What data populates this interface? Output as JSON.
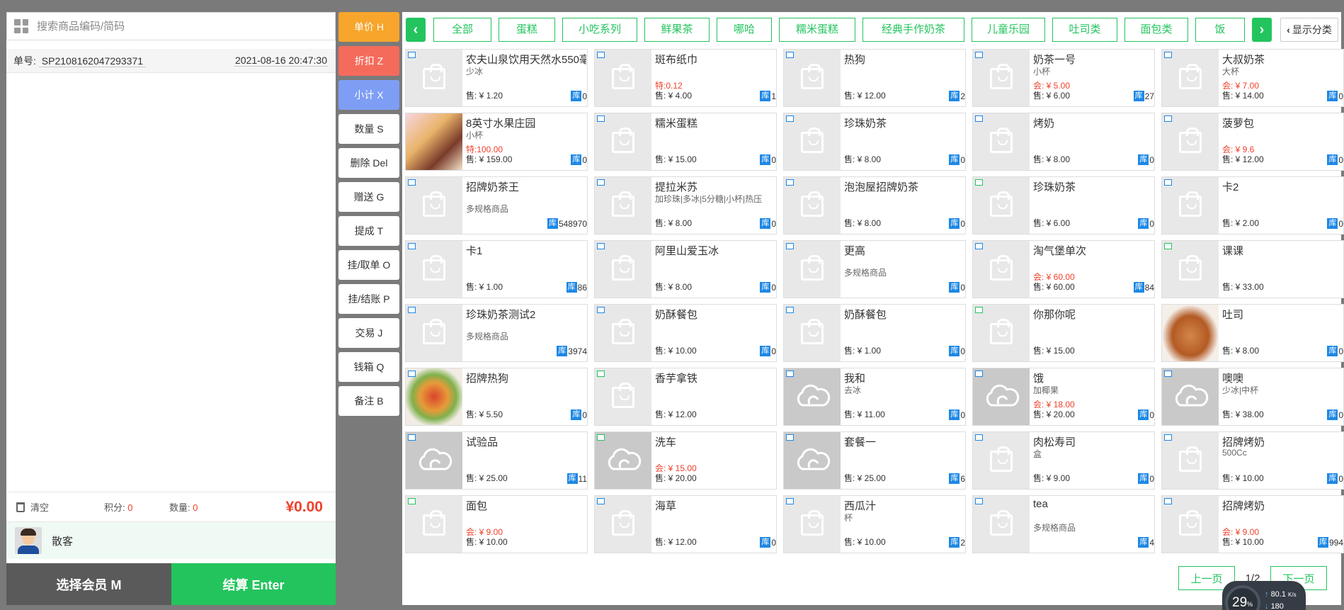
{
  "search": {
    "placeholder": "搜索商品编码/简码"
  },
  "order": {
    "no_label": "单号:",
    "no": "SP2108162047293371",
    "datetime": "2021-08-16 20:47:30"
  },
  "summary": {
    "clear": "清空",
    "points_label": "积分:",
    "points": "0",
    "qty_label": "数量:",
    "qty": "0",
    "total": "¥0.00"
  },
  "member": {
    "name": "散客"
  },
  "bottom": {
    "select_member": "选择会员 M",
    "settle": "结算 Enter"
  },
  "functions": [
    {
      "label": "单价 H",
      "style": "orange"
    },
    {
      "label": "折扣 Z",
      "style": "red"
    },
    {
      "label": "小计 X",
      "style": "blue"
    },
    {
      "label": "数量 S",
      "style": ""
    },
    {
      "label": "删除 Del",
      "style": ""
    },
    {
      "label": "赠送 G",
      "style": ""
    },
    {
      "label": "提成 T",
      "style": ""
    },
    {
      "label": "挂/取单 O",
      "style": ""
    },
    {
      "label": "挂/结账 P",
      "style": ""
    },
    {
      "label": "交易 J",
      "style": ""
    },
    {
      "label": "钱箱 Q",
      "style": ""
    },
    {
      "label": "备注 B",
      "style": ""
    }
  ],
  "categories": [
    "全部",
    "蛋糕",
    "小吃系列",
    "鲜果茶",
    "哪哈",
    "糯米蛋糕",
    "经典手作奶茶",
    "儿童乐园",
    "吐司类",
    "面包类",
    "饭"
  ],
  "show_categories": "显示分类",
  "stock_label": "库",
  "products": [
    {
      "name": "农夫山泉饮用天然水550毫",
      "sub": "少冰",
      "price": "售: ¥ 1.20",
      "stock": "0",
      "thumb": "bag",
      "tag": "b"
    },
    {
      "name": "斑布纸巾",
      "promo": "特:0.12",
      "price": "售: ¥ 4.00",
      "stock": "1",
      "thumb": "bag",
      "tag": "b"
    },
    {
      "name": "热狗",
      "price": "售: ¥ 12.00",
      "stock": "2",
      "thumb": "bag",
      "tag": "b"
    },
    {
      "name": "奶茶一号",
      "sub": "小杯",
      "promo": "会: ¥ 5.00",
      "price": "售: ¥ 6.00",
      "stock": "27",
      "thumb": "bag",
      "tag": "b"
    },
    {
      "name": "大叔奶茶",
      "sub": "大杯",
      "promo": "会: ¥ 7.00",
      "price": "售: ¥ 14.00",
      "stock": "0",
      "thumb": "bag",
      "tag": "b"
    },
    {
      "name": "8英寸水果庄园",
      "sub": "小杯",
      "promo": "特:100.00",
      "price": "售: ¥ 159.00",
      "stock": "0",
      "thumb": "cake",
      "tag": ""
    },
    {
      "name": "糯米蛋糕",
      "price": "售: ¥ 15.00",
      "stock": "0",
      "thumb": "bag",
      "tag": "b"
    },
    {
      "name": "珍珠奶茶",
      "price": "售: ¥ 8.00",
      "stock": "0",
      "thumb": "bag",
      "tag": "b"
    },
    {
      "name": "烤奶",
      "price": "售: ¥ 8.00",
      "stock": "0",
      "thumb": "bag",
      "tag": "b"
    },
    {
      "name": "菠萝包",
      "promo": "会: ¥ 9.6",
      "price": "售: ¥ 12.00",
      "stock": "0",
      "thumb": "bag",
      "tag": "b"
    },
    {
      "name": "招牌奶茶王",
      "spec": "多规格商品",
      "stock": "548970",
      "thumb": "bag",
      "tag": "b"
    },
    {
      "name": "提拉米苏",
      "sub": "加珍珠|多冰|5分糖|小杯|热压",
      "price": "售: ¥ 8.00",
      "stock": "0",
      "thumb": "bag",
      "tag": "b"
    },
    {
      "name": "泡泡屋招牌奶茶",
      "price": "售: ¥ 8.00",
      "stock": "0",
      "thumb": "bag",
      "tag": "b"
    },
    {
      "name": "珍珠奶茶",
      "price": "售: ¥ 6.00",
      "stock": "0",
      "thumb": "bag",
      "tag": "g"
    },
    {
      "name": "卡2",
      "price": "售: ¥ 2.00",
      "stock": "0",
      "thumb": "bag",
      "tag": "b"
    },
    {
      "name": "卡1",
      "price": "售: ¥ 1.00",
      "stock": "86",
      "thumb": "bag",
      "tag": "b"
    },
    {
      "name": "阿里山爱玉冰",
      "price": "售: ¥ 8.00",
      "stock": "0",
      "thumb": "bag",
      "tag": "b"
    },
    {
      "name": "更高",
      "spec": "多规格商品",
      "stock": "0",
      "thumb": "bag",
      "tag": "b"
    },
    {
      "name": "淘气堡单次",
      "promo": "会: ¥ 60.00",
      "price": "售: ¥ 60.00",
      "stock": "84",
      "thumb": "bag",
      "tag": "b"
    },
    {
      "name": "课课",
      "price": "售: ¥ 33.00",
      "thumb": "bag",
      "tag": "g"
    },
    {
      "name": "珍珠奶茶测试2",
      "spec": "多规格商品",
      "stock": "3974",
      "thumb": "bag",
      "tag": "b"
    },
    {
      "name": "奶酥餐包",
      "price": "售: ¥ 10.00",
      "stock": "0",
      "thumb": "bag",
      "tag": "b"
    },
    {
      "name": "奶酥餐包",
      "price": "售: ¥ 1.00",
      "stock": "0",
      "thumb": "bag",
      "tag": "b"
    },
    {
      "name": "你那你呢",
      "price": "售: ¥ 15.00",
      "thumb": "bag",
      "tag": "g"
    },
    {
      "name": "吐司",
      "price": "售: ¥ 8.00",
      "stock": "0",
      "thumb": "bread",
      "tag": ""
    },
    {
      "name": "招牌热狗",
      "price": "售: ¥ 5.50",
      "stock": "0",
      "thumb": "hotdog",
      "tag": "b"
    },
    {
      "name": "香芋拿铁",
      "price": "售: ¥ 12.00",
      "thumb": "bag",
      "tag": "g"
    },
    {
      "name": "我和",
      "sub": "去冰",
      "price": "售: ¥ 11.00",
      "stock": "0",
      "thumb": "cloud",
      "tag": "b"
    },
    {
      "name": "饿",
      "sub": "加椰果",
      "promo": "会: ¥ 18.00",
      "price": "售: ¥ 20.00",
      "stock": "0",
      "thumb": "cloud",
      "tag": "b"
    },
    {
      "name": "噢噢",
      "sub": "少冰|中杯",
      "price": "售: ¥ 38.00",
      "stock": "0",
      "thumb": "cloud",
      "tag": "b"
    },
    {
      "name": "试验品",
      "price": "售: ¥ 25.00",
      "stock": "11",
      "thumb": "cloud",
      "tag": "b"
    },
    {
      "name": "洗车",
      "promo": "会: ¥ 15.00",
      "price": "售: ¥ 20.00",
      "thumb": "cloud",
      "tag": "g"
    },
    {
      "name": "套餐一",
      "price": "售: ¥ 25.00",
      "stock": "6",
      "thumb": "cloud",
      "tag": "b"
    },
    {
      "name": "肉松寿司",
      "sub": "盒",
      "price": "售: ¥ 9.00",
      "stock": "0",
      "thumb": "bag",
      "tag": "b"
    },
    {
      "name": "招牌烤奶",
      "sub": "500Cc",
      "price": "售: ¥ 10.00",
      "stock": "0",
      "thumb": "bag",
      "tag": "b"
    },
    {
      "name": "面包",
      "promo": "会: ¥ 9.00",
      "price": "售: ¥ 10.00",
      "thumb": "bag",
      "tag": "g"
    },
    {
      "name": "海草",
      "price": "售: ¥ 12.00",
      "stock": "0",
      "thumb": "bag",
      "tag": "b"
    },
    {
      "name": "西瓜汁",
      "sub": "杯",
      "price": "售: ¥ 10.00",
      "stock": "2",
      "thumb": "bag",
      "tag": "b"
    },
    {
      "name": "tea",
      "spec": "多规格商品",
      "stock": "4",
      "thumb": "bag",
      "tag": "b"
    },
    {
      "name": "招牌烤奶",
      "promo": "会: ¥ 9.00",
      "price": "售: ¥ 10.00",
      "stock": "994",
      "thumb": "bag",
      "tag": "b"
    }
  ],
  "pager": {
    "prev": "上一页",
    "page": "1/2",
    "next": "下一页"
  },
  "network": {
    "percent": "29",
    "upload": "80.1",
    "upload_unit": "K/s",
    "download": "180"
  },
  "colors": {
    "accent": "#23c45e",
    "price_red": "#f0412b",
    "stock_blue": "#1e88e5",
    "sidebar_bg": "#7a7a7a"
  }
}
